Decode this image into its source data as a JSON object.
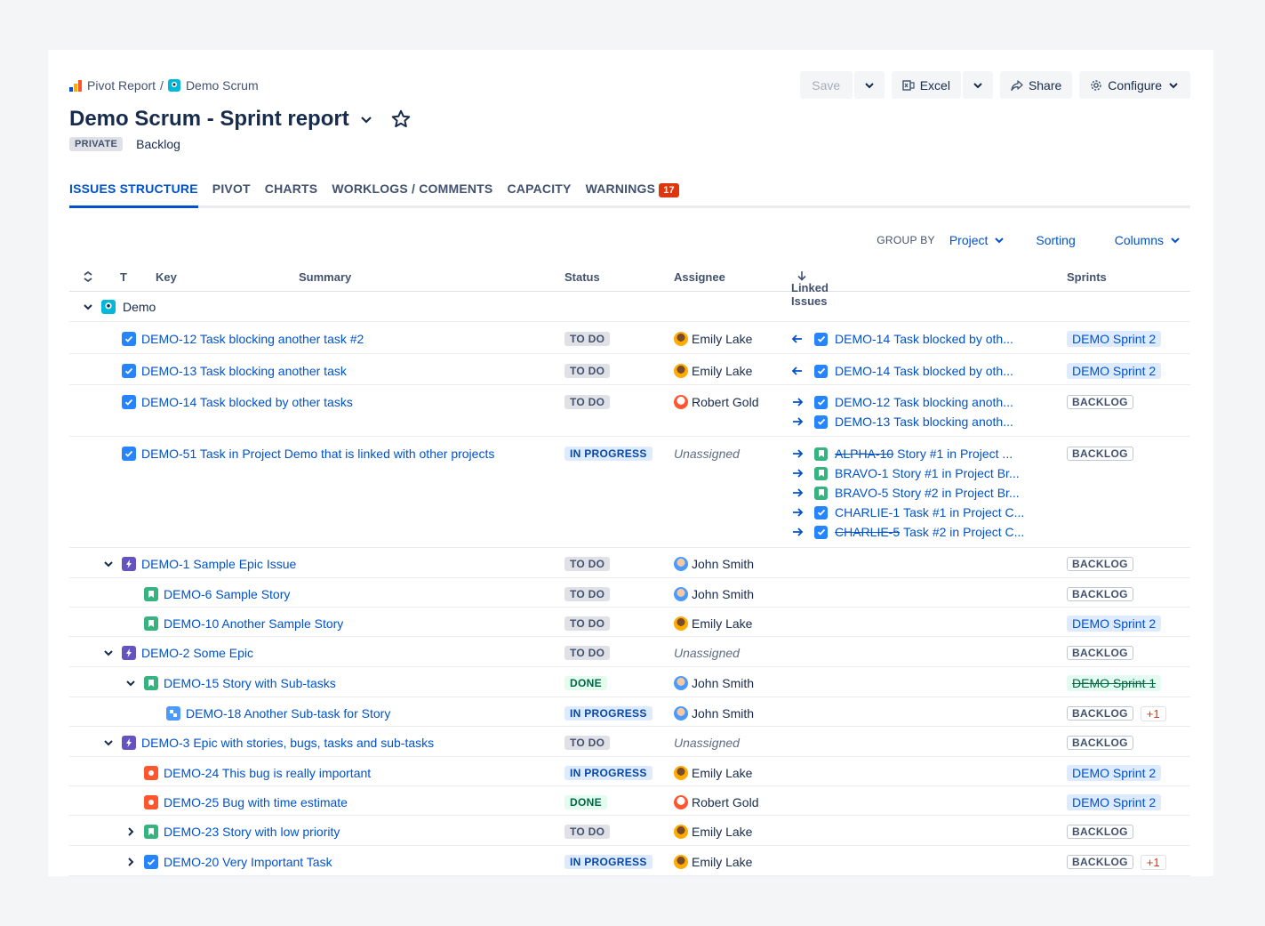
{
  "breadcrumb": {
    "root": "Pivot Report",
    "separator": "/",
    "project": "Demo Scrum"
  },
  "title": "Demo Scrum - Sprint report",
  "visibility": "PRIVATE",
  "meta_text": "Backlog",
  "toolbar": {
    "save": "Save",
    "excel": "Excel",
    "share": "Share",
    "configure": "Configure"
  },
  "tabs": [
    {
      "label": "ISSUES STRUCTURE",
      "active": true
    },
    {
      "label": "PIVOT"
    },
    {
      "label": "CHARTS"
    },
    {
      "label": "WORKLOGS / COMMENTS"
    },
    {
      "label": "CAPACITY"
    },
    {
      "label": "WARNINGS",
      "badge": "17"
    }
  ],
  "groupbar": {
    "label": "GROUP BY",
    "group": "Project",
    "sorting": "Sorting",
    "columns": "Columns"
  },
  "columns": {
    "t": "T",
    "key": "Key",
    "summary": "Summary",
    "status": "Status",
    "assignee": "Assignee",
    "linked": "Linked Issues",
    "sprints": "Sprints"
  },
  "group_row": {
    "label": "Demo"
  },
  "rows": [
    {
      "key": "DEMO-12 Task blocking another task #2",
      "type": "task",
      "status": "TO DO",
      "assignee": "Emily Lake",
      "sprint": "DEMO Sprint 2",
      "linked": [
        {
          "dir": "in",
          "type": "task",
          "key": "DEMO-14",
          "text": "Task blocked by oth..."
        }
      ]
    },
    {
      "key": "DEMO-13 Task blocking another task",
      "type": "task",
      "status": "TO DO",
      "assignee": "Emily Lake",
      "sprint": "DEMO Sprint 2",
      "linked": [
        {
          "dir": "in",
          "type": "task",
          "key": "DEMO-14",
          "text": "Task blocked by oth..."
        }
      ]
    },
    {
      "key": "DEMO-14 Task blocked by other tasks",
      "type": "task",
      "status": "TO DO",
      "assignee": "Robert Gold",
      "sprint": "BACKLOG",
      "linked": [
        {
          "dir": "out",
          "type": "task",
          "key": "DEMO-12",
          "text": "Task blocking anoth..."
        },
        {
          "dir": "out",
          "type": "task",
          "key": "DEMO-13",
          "text": "Task blocking anoth..."
        }
      ]
    },
    {
      "key": "DEMO-51 Task in Project Demo that is linked with other projects",
      "type": "task",
      "status": "IN PROGRESS",
      "assignee": "Unassigned",
      "sprint": "BACKLOG",
      "linked": [
        {
          "dir": "out",
          "type": "story",
          "key": "ALPHA-10",
          "text": "Story #1 in Project ...",
          "strike": true
        },
        {
          "dir": "out",
          "type": "story",
          "key": "BRAVO-1",
          "text": "Story #1 in Project Br..."
        },
        {
          "dir": "out",
          "type": "story",
          "key": "BRAVO-5",
          "text": "Story #2 in Project Br..."
        },
        {
          "dir": "out",
          "type": "task",
          "key": "CHARLIE-1",
          "text": "Task #1 in Project C..."
        },
        {
          "dir": "out",
          "type": "task",
          "key": "CHARLIE-5",
          "text": "Task #2 in Project C...",
          "strike": true
        }
      ]
    },
    {
      "key": "DEMO-1 Sample Epic Issue",
      "type": "epic",
      "status": "TO DO",
      "assignee": "John Smith",
      "sprint": "BACKLOG"
    },
    {
      "key": "DEMO-6 Sample Story",
      "type": "story",
      "status": "TO DO",
      "assignee": "John Smith",
      "sprint": "BACKLOG"
    },
    {
      "key": "DEMO-10 Another Sample Story",
      "type": "story",
      "status": "TO DO",
      "assignee": "Emily Lake",
      "sprint": "DEMO Sprint 2"
    },
    {
      "key": "DEMO-2 Some Epic",
      "type": "epic",
      "status": "TO DO",
      "assignee": "Unassigned",
      "sprint": "BACKLOG"
    },
    {
      "key": "DEMO-15 Story with Sub-tasks",
      "type": "story",
      "status": "DONE",
      "assignee": "John Smith",
      "sprint": "DEMO Sprint 1"
    },
    {
      "key": "DEMO-18 Another Sub-task for Story",
      "type": "subtask",
      "status": "IN PROGRESS",
      "assignee": "John Smith",
      "sprint": "BACKLOG",
      "extra": "+1"
    },
    {
      "key": "DEMO-3 Epic with stories, bugs, tasks and sub-tasks",
      "type": "epic",
      "status": "TO DO",
      "assignee": "Unassigned",
      "sprint": "BACKLOG"
    },
    {
      "key": "DEMO-24 This bug is really important",
      "type": "bug",
      "status": "IN PROGRESS",
      "assignee": "Emily Lake",
      "sprint": "DEMO Sprint 2"
    },
    {
      "key": "DEMO-25 Bug with time estimate",
      "type": "bug",
      "status": "DONE",
      "assignee": "Robert Gold",
      "sprint": "DEMO Sprint 2"
    },
    {
      "key": "DEMO-23 Story with low priority",
      "type": "story",
      "status": "TO DO",
      "assignee": "Emily Lake",
      "sprint": "BACKLOG"
    },
    {
      "key": "DEMO-20 Very Important Task",
      "type": "task",
      "status": "IN PROGRESS",
      "assignee": "Emily Lake",
      "sprint": "BACKLOG",
      "extra": "+1"
    }
  ]
}
